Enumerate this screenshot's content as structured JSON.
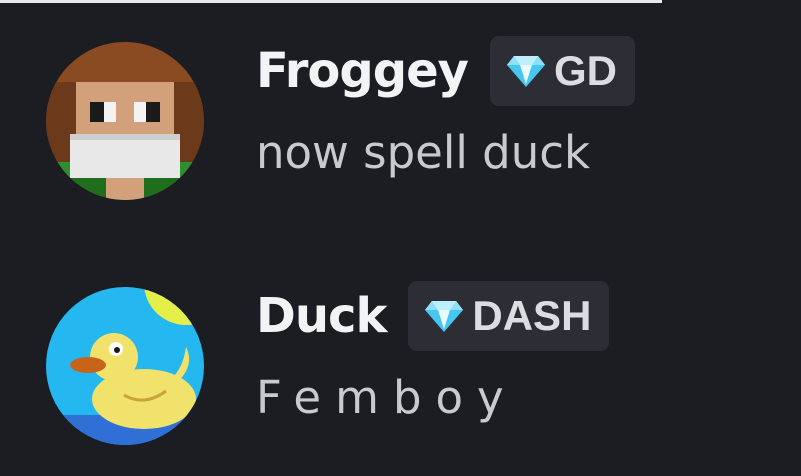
{
  "messages": [
    {
      "author": "Froggey",
      "tag": {
        "icon": "diamond-icon",
        "label": "GD"
      },
      "text": "now spell duck",
      "avatar": "pixel-character-avatar"
    },
    {
      "author": "Duck",
      "tag": {
        "icon": "diamond-icon",
        "label": "DASH"
      },
      "text": "Femboy",
      "avatar": "rubber-duck-avatar"
    }
  ],
  "colors": {
    "background": "#1c1d22",
    "tag_background": "#2d2e35",
    "username": "#f2f3f5",
    "message_text": "#c9cace",
    "gem": "#46c7f0"
  }
}
